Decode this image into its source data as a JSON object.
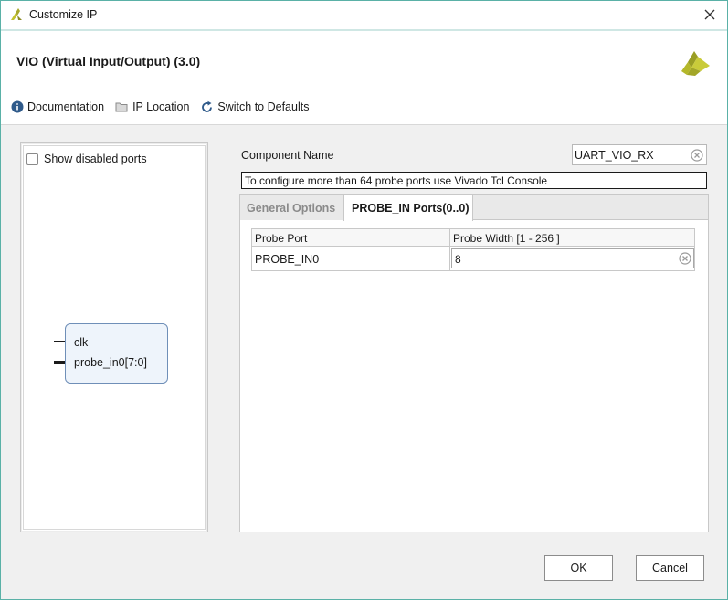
{
  "window": {
    "title": "Customize IP"
  },
  "header": {
    "ip_title": "VIO (Virtual Input/Output) (3.0)",
    "toolbar": {
      "documentation": "Documentation",
      "ip_location": "IP Location",
      "switch_defaults": "Switch to Defaults"
    }
  },
  "left_panel": {
    "show_disabled_label": "Show disabled ports",
    "show_disabled_checked": false,
    "symbol": {
      "port_clk": "clk",
      "port_probe": "probe_in0[7:0]"
    }
  },
  "right_panel": {
    "component_name_label": "Component Name",
    "component_name_value": "UART_VIO_RX",
    "info_text": "To configure more than 64 probe ports use Vivado Tcl Console",
    "tabs": [
      {
        "label": "General Options",
        "active": false
      },
      {
        "label": "PROBE_IN Ports(0..0)",
        "active": true
      }
    ],
    "table": {
      "headers": [
        "Probe Port",
        "Probe Width [1 - 256 ]"
      ],
      "rows": [
        {
          "port": "PROBE_IN0",
          "width": "8"
        }
      ]
    }
  },
  "buttons": {
    "ok": "OK",
    "cancel": "Cancel"
  },
  "colors": {
    "window_border": "#5ab1a7",
    "symbol_border": "#6f8fb8",
    "symbol_fill": "#eef4fb",
    "logo": "#b4b82a"
  },
  "icons": {
    "app": "xilinx-logo-icon",
    "close": "close-icon",
    "documentation": "info-icon",
    "ip_location": "folder-icon",
    "switch_defaults": "refresh-icon",
    "clear": "clear-circle-icon"
  }
}
